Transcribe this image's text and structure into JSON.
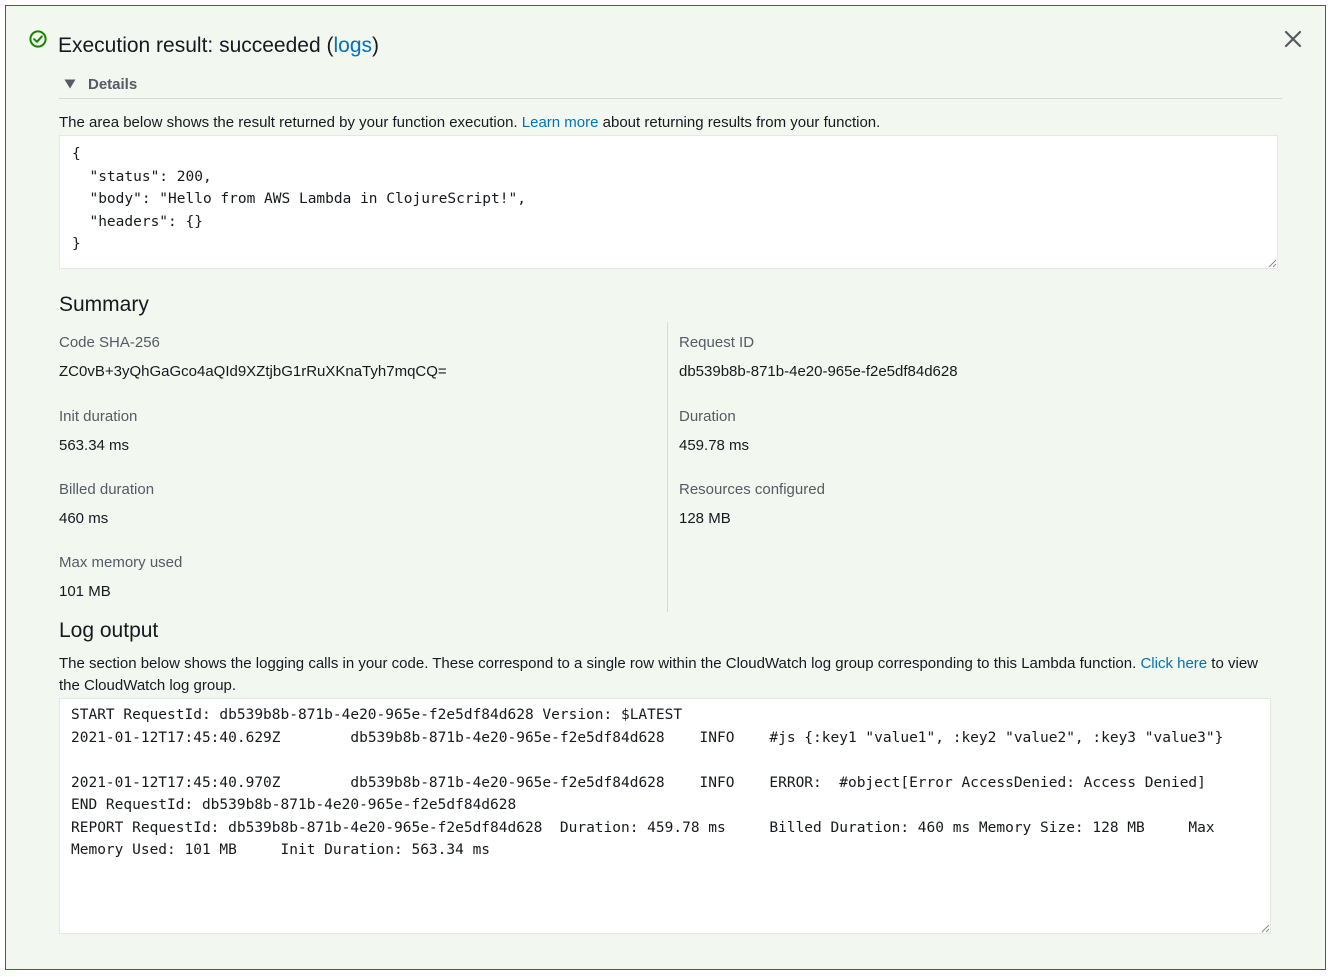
{
  "header": {
    "title_prefix": "Execution result: succeeded (",
    "logs_link": "logs",
    "title_suffix": ")",
    "status": "succeeded",
    "status_color": "#1d8102",
    "status_icon": "check-circle-icon",
    "close_icon": "close-icon"
  },
  "details": {
    "label": "Details",
    "caret_icon": "caret-down-icon"
  },
  "result": {
    "desc_prefix": "The area below shows the result returned by your function execution. ",
    "learn_more_link": "Learn more",
    "desc_suffix": " about returning results from your function.",
    "output": "{\n  \"status\": 200,\n  \"body\": \"Hello from AWS Lambda in ClojureScript!\",\n  \"headers\": {}\n}"
  },
  "summary": {
    "title": "Summary",
    "left": [
      {
        "label": "Code SHA-256",
        "value": "ZC0vB+3yQhGaGco4aQId9XZtjbG1rRuXKnaTyh7mqCQ="
      },
      {
        "label": "Init duration",
        "value": "563.34 ms"
      },
      {
        "label": "Billed duration",
        "value": "460 ms"
      },
      {
        "label": "Max memory used",
        "value": "101 MB"
      }
    ],
    "right": [
      {
        "label": "Request ID",
        "value": "db539b8b-871b-4e20-965e-f2e5df84d628"
      },
      {
        "label": "Duration",
        "value": "459.78 ms"
      },
      {
        "label": "Resources configured",
        "value": "128 MB"
      }
    ]
  },
  "log": {
    "title": "Log output",
    "desc_prefix": "The section below shows the logging calls in your code. These correspond to a single row within the CloudWatch log group corresponding to this Lambda function. ",
    "click_here_link": "Click here",
    "desc_suffix": " to view the CloudWatch log group.",
    "output": "START RequestId: db539b8b-871b-4e20-965e-f2e5df84d628 Version: $LATEST\n2021-01-12T17:45:40.629Z\tdb539b8b-871b-4e20-965e-f2e5df84d628\tINFO\t#js {:key1 \"value1\", :key2 \"value2\", :key3 \"value3\"}\n\n2021-01-12T17:45:40.970Z\tdb539b8b-871b-4e20-965e-f2e5df84d628\tINFO\tERROR:  #object[Error AccessDenied: Access Denied]\nEND RequestId: db539b8b-871b-4e20-965e-f2e5df84d628\nREPORT RequestId: db539b8b-871b-4e20-965e-f2e5df84d628\tDuration: 459.78 ms\tBilled Duration: 460 ms\tMemory Size: 128 MB\tMax Memory Used: 101 MB\tInit Duration: 563.34 ms\t"
  }
}
